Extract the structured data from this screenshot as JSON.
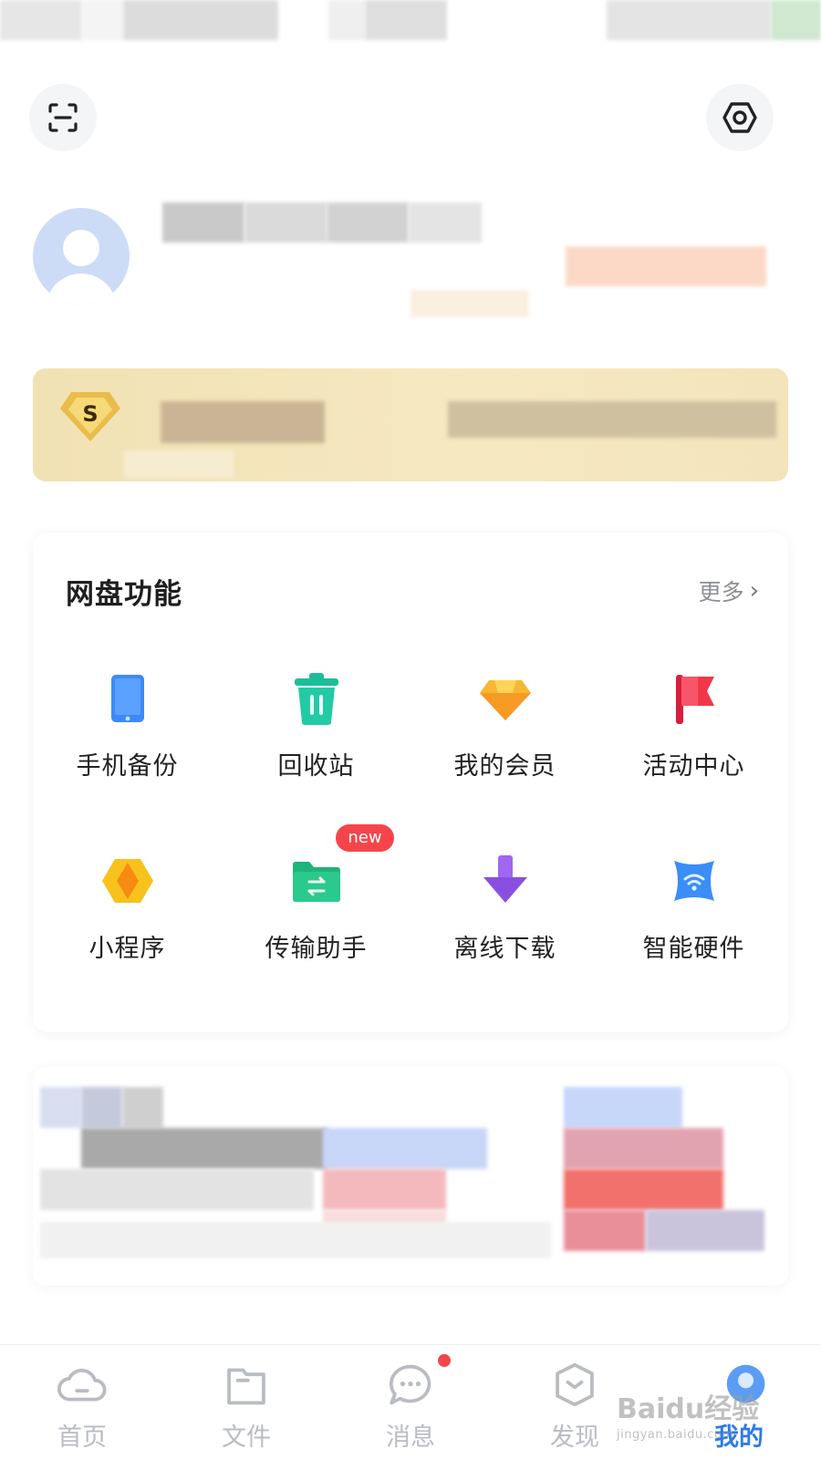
{
  "header": {
    "scan_icon": "scan-icon",
    "settings_icon": "settings-icon"
  },
  "functions": {
    "title": "网盘功能",
    "more_label": "更多",
    "items": [
      {
        "label": "手机备份",
        "icon": "phone-backup-icon",
        "color": "#3d8af7"
      },
      {
        "label": "回收站",
        "icon": "recycle-bin-icon",
        "color": "#1dbd9a"
      },
      {
        "label": "我的会员",
        "icon": "vip-diamond-icon",
        "color": "#f7b731"
      },
      {
        "label": "活动中心",
        "icon": "flag-icon",
        "color": "#f0384a"
      },
      {
        "label": "小程序",
        "icon": "mini-program-icon",
        "color": "#f7a418"
      },
      {
        "label": "传输助手",
        "icon": "transfer-folder-icon",
        "color": "#1fb47a",
        "badge": "new"
      },
      {
        "label": "离线下载",
        "icon": "download-arrow-icon",
        "color": "#8a4fe0"
      },
      {
        "label": "智能硬件",
        "icon": "smart-hardware-icon",
        "color": "#3a8ef6"
      }
    ]
  },
  "vip_banner": {
    "badge_letter": "S"
  },
  "bottom_nav": {
    "items": [
      {
        "label": "首页",
        "icon": "cloud-icon",
        "active": false
      },
      {
        "label": "文件",
        "icon": "folder-icon",
        "active": false
      },
      {
        "label": "消息",
        "icon": "message-icon",
        "active": false,
        "unread_dot": true
      },
      {
        "label": "发现",
        "icon": "discover-icon",
        "active": false
      },
      {
        "label": "我的",
        "icon": "profile-icon",
        "active": true
      }
    ]
  },
  "watermark": {
    "text": "Baidu经验",
    "sub": "jingyan.baidu.com"
  }
}
